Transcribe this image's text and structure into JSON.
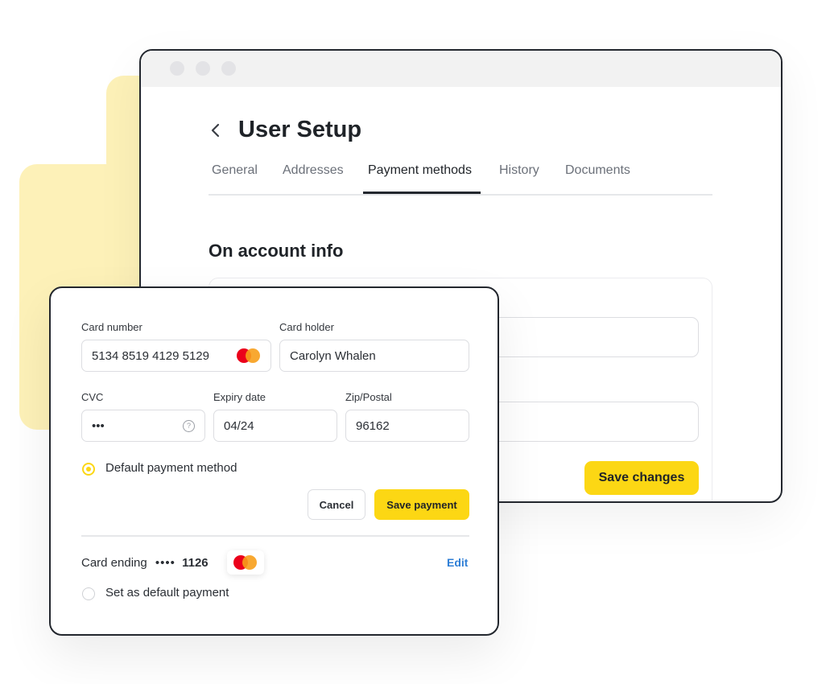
{
  "window": {
    "title": "User Setup",
    "tabs": [
      {
        "label": "General"
      },
      {
        "label": "Addresses"
      },
      {
        "label": "Payment methods",
        "active": true
      },
      {
        "label": "History"
      },
      {
        "label": "Documents"
      }
    ],
    "section_title": "On account info",
    "save_changes_label": "Save changes"
  },
  "payment_form": {
    "card_number_label": "Card number",
    "card_number_value": "5134 8519 4129 5129",
    "card_holder_label": "Card holder",
    "card_holder_value": "Carolyn Whalen",
    "cvc_label": "CVC",
    "cvc_value": "•••",
    "expiry_label": "Expiry date",
    "expiry_value": "04/24",
    "zip_label": "Zip/Postal",
    "zip_value": "96162",
    "default_method_label": "Default payment method",
    "default_method_selected": true,
    "cancel_label": "Cancel",
    "save_payment_label": "Save payment"
  },
  "saved_card": {
    "ending_label": "Card ending",
    "mask": "••••",
    "last4": "1126",
    "edit_label": "Edit",
    "set_default_label": "Set as default payment",
    "set_default_selected": false
  },
  "icons": {
    "back": "chevron-left-icon",
    "card_brand": "mastercard-icon",
    "cvc_help": "question-circle-icon"
  },
  "colors": {
    "accent_yellow": "#fcd714",
    "decor_yellow": "#fdf1b8",
    "link_blue": "#2f7fd6",
    "mastercard_red": "#eb001b",
    "mastercard_orange": "#f79e1b"
  }
}
